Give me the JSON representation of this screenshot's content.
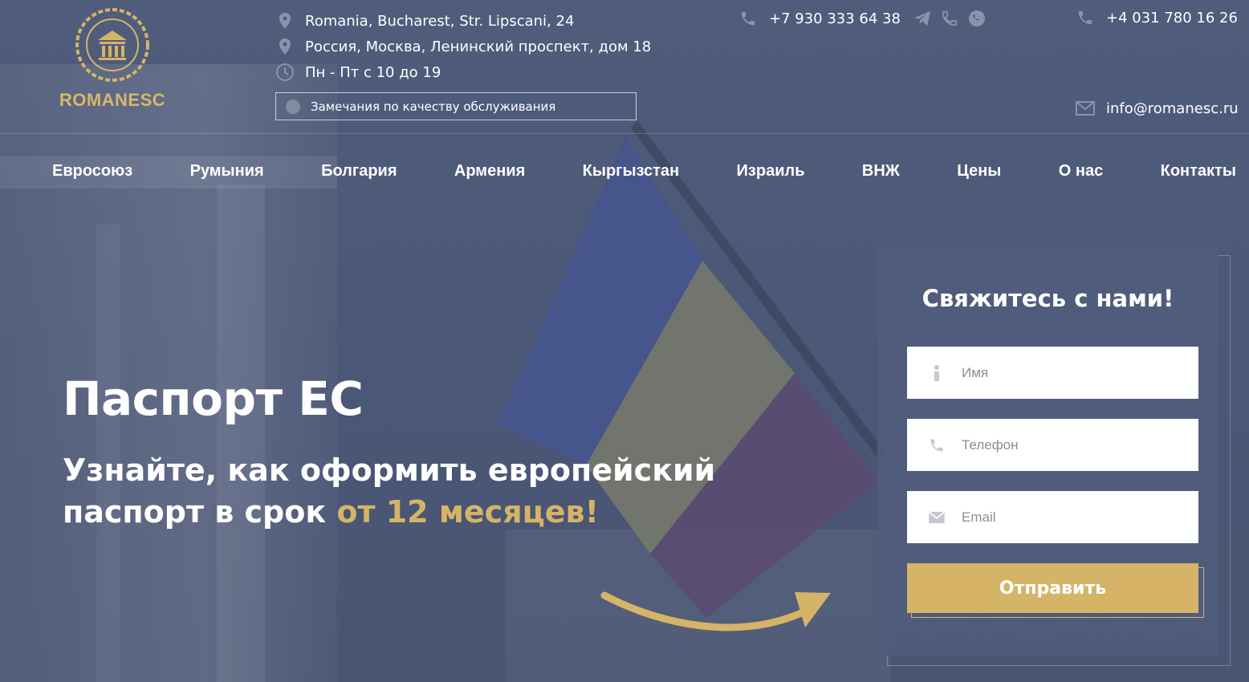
{
  "brand": {
    "name": "ROMANESC",
    "accent_color": "#d5b467",
    "logo_icon": "laurel-building-icon"
  },
  "header": {
    "address_ro": "Romania, Bucharest, Str. Lipscani, 24",
    "address_ru": "Россия, Москва, Ленинский проспект, дом 18",
    "hours": "Пн - Пт с 10 до 19",
    "complaint_label": "Замечания по качеству обслуживания",
    "phone_ru": "+7 930 333 64 38",
    "phone_ro": "+4 031 780 16 26",
    "email": "info@romanesc.ru",
    "messenger_icons": [
      "telegram-icon",
      "viber-icon",
      "whatsapp-icon"
    ]
  },
  "nav": {
    "items": [
      "Евросоюз",
      "Румыния",
      "Болгария",
      "Армения",
      "Кыргызстан",
      "Израиль",
      "ВНЖ",
      "Цены",
      "О нас",
      "Контакты"
    ]
  },
  "hero": {
    "title": "Паспорт ЕС",
    "subtitle_part1": "Узнайте, как оформить европейский паспорт в срок ",
    "subtitle_accent": "от 12 месяцев!"
  },
  "form": {
    "title": "Свяжитесь с нами!",
    "name_placeholder": "Имя",
    "phone_placeholder": "Телефон",
    "email_placeholder": "Email",
    "submit_label": "Отправить"
  }
}
